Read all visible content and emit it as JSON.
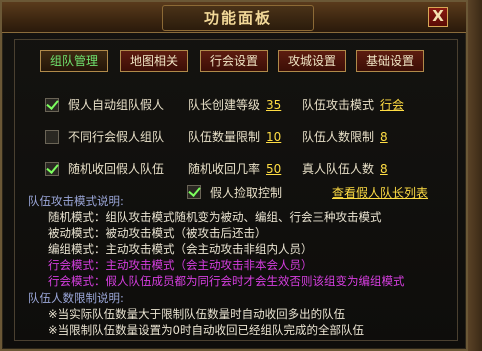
{
  "window": {
    "title": "功能面板",
    "close_label": "X"
  },
  "tabs": [
    {
      "label": "组队管理",
      "active": true
    },
    {
      "label": "地图相关"
    },
    {
      "label": "行会设置"
    },
    {
      "label": "攻城设置"
    },
    {
      "label": "基础设置"
    }
  ],
  "options": {
    "auto_team": {
      "label": "假人自动组队假人",
      "checked": true
    },
    "diff_guild": {
      "label": "不同行会假人组队",
      "checked": false
    },
    "random_recall": {
      "label": "随机收回假人队伍",
      "checked": true
    },
    "pickup": {
      "label": "假人捡取控制",
      "checked": true
    }
  },
  "fields": {
    "leader_level_label": "队长创建等级",
    "leader_level_value": "35",
    "team_limit_label": "队伍数量限制",
    "team_limit_value": "10",
    "recall_chance_label": "随机收回几率",
    "recall_chance_value": "50",
    "attack_mode_label": "队伍攻击模式",
    "attack_mode_value": "行会",
    "member_limit_label": "队伍人数限制",
    "member_limit_value": "8",
    "real_member_label": "真人队伍人数",
    "real_member_value": "8"
  },
  "view_leader_list": "查看假人队长列表",
  "attack_desc": {
    "heading": "队伍攻击模式说明:",
    "lines": [
      "随机模式：组队攻击模式随机变为被动、编组、行会三种攻击模式",
      "被动模式：被动攻击模式（被攻击后还击）",
      "编组模式：主动攻击模式（会主动攻击非组内人员）",
      "行会模式：主动攻击模式（会主动攻击非本会人员）",
      "行会模式：假人队伍成员都为同行会时才会生效否则该组变为编组模式"
    ]
  },
  "member_desc": {
    "heading": "队伍人数限制说明:",
    "lines": [
      "※当实际队伍数量大于限制队伍数量时自动收回多出的队伍",
      "※当限制队伍数量设置为0时自动收回已经组队完成的全部队伍"
    ]
  }
}
